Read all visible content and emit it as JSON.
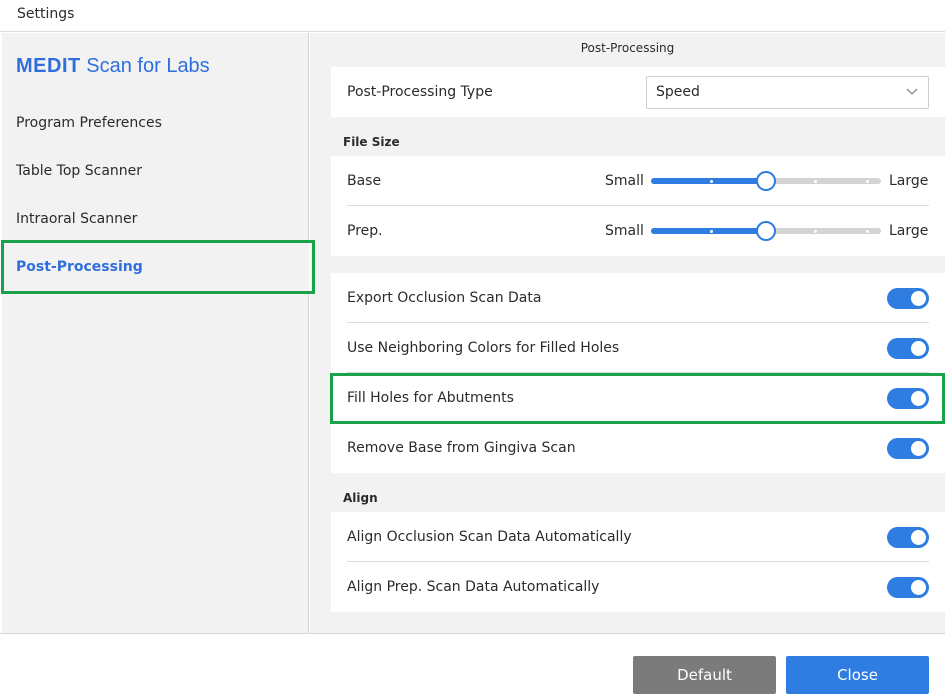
{
  "window": {
    "title": "Settings"
  },
  "sidebar": {
    "brand_strong": "MEDIT",
    "brand_rest": " Scan for Labs",
    "items": [
      {
        "label": "Program Preferences"
      },
      {
        "label": "Table Top Scanner"
      },
      {
        "label": "Intraoral Scanner"
      },
      {
        "label": "Post-Processing",
        "active": true
      }
    ]
  },
  "main": {
    "section_title": "Post-Processing",
    "post_processing_type": {
      "label": "Post-Processing Type",
      "value": "Speed"
    },
    "file_size": {
      "group_label": "File Size",
      "rows": [
        {
          "label": "Base",
          "min_label": "Small",
          "max_label": "Large",
          "value": 0.5
        },
        {
          "label": "Prep.",
          "min_label": "Small",
          "max_label": "Large",
          "value": 0.5
        }
      ]
    },
    "options": [
      {
        "label": "Export Occlusion Scan Data",
        "on": true
      },
      {
        "label": "Use Neighboring Colors for Filled Holes",
        "on": true
      },
      {
        "label": "Fill Holes for Abutments",
        "on": true
      },
      {
        "label": "Remove Base from Gingiva Scan",
        "on": true
      }
    ],
    "align": {
      "group_label": "Align",
      "rows": [
        {
          "label": "Align Occlusion Scan Data Automatically",
          "on": true
        },
        {
          "label": "Align Prep. Scan Data Automatically",
          "on": true
        }
      ]
    }
  },
  "footer": {
    "default_label": "Default",
    "close_label": "Close"
  },
  "colors": {
    "accent": "#2f7de1",
    "brand": "#2f6fdc",
    "highlight": "#1aa24a",
    "default_button": "#7b7b7b"
  }
}
